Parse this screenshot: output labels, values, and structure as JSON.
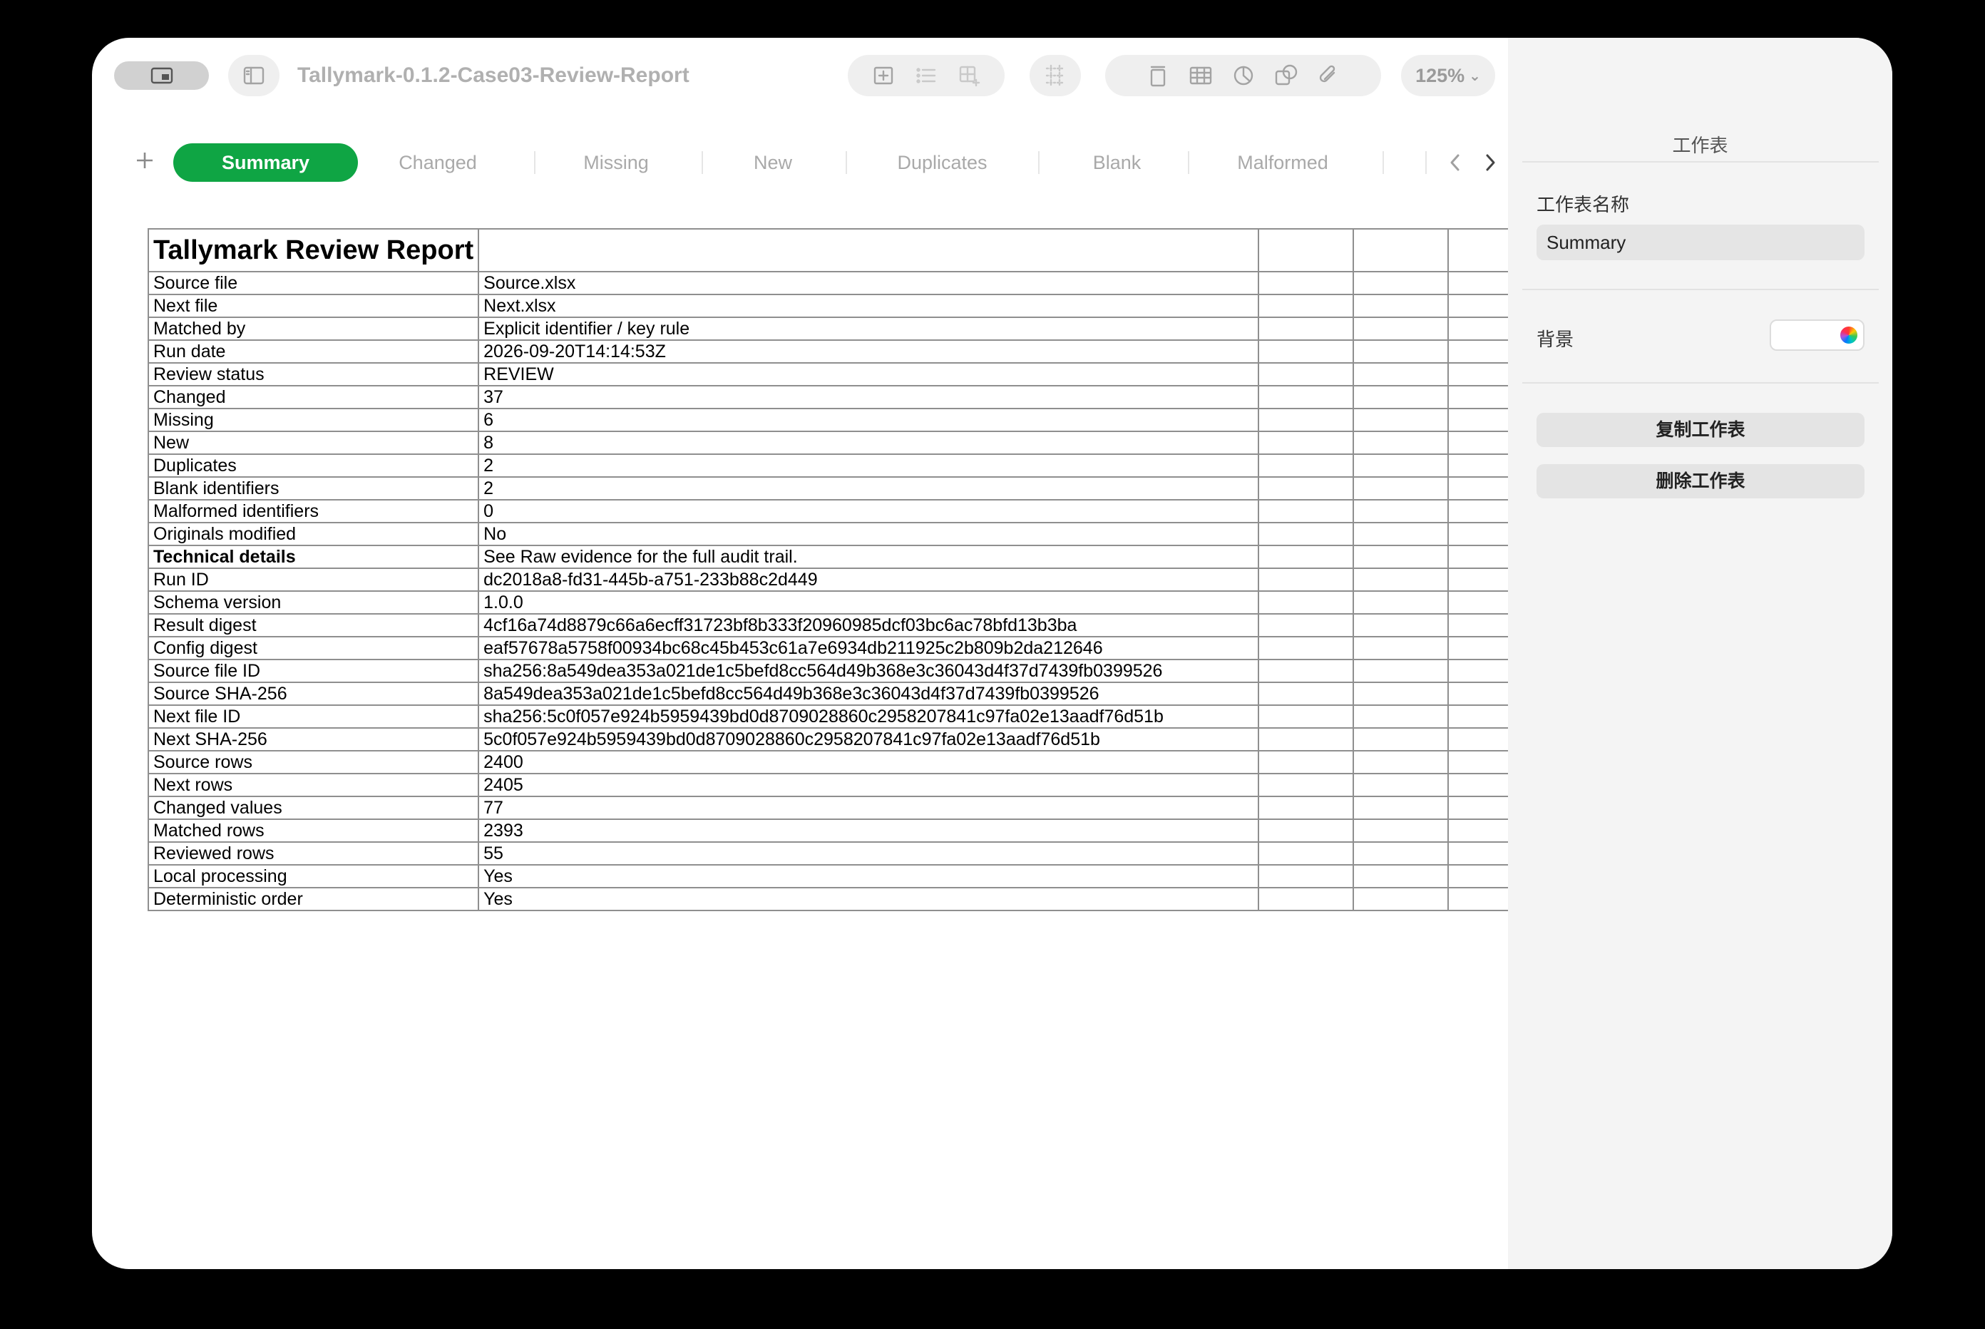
{
  "window": {
    "title": "Tallymark-0.1.2-Case03-Review-Report",
    "zoom": "125%"
  },
  "toolbar": {
    "icons": [
      "sidebar-toggle-icon",
      "sidebar-icon",
      "insert-icon",
      "list-icon",
      "table-add-icon",
      "grid-icon",
      "text-box-icon",
      "table-icon",
      "chart-icon",
      "shape-icon",
      "attachment-icon",
      "comment-icon",
      "share-icon",
      "format-brush-icon",
      "organize-icon"
    ]
  },
  "tabs": [
    {
      "label": "Summary",
      "active": true
    },
    {
      "label": "Changed",
      "active": false
    },
    {
      "label": "Missing",
      "active": false
    },
    {
      "label": "New",
      "active": false
    },
    {
      "label": "Duplicates",
      "active": false
    },
    {
      "label": "Blank",
      "active": false
    },
    {
      "label": "Malformed",
      "active": false
    }
  ],
  "sheet": {
    "title": "Tallymark Review Report",
    "rows": [
      {
        "label": "Source file",
        "value": "Source.xlsx"
      },
      {
        "label": "Next file",
        "value": "Next.xlsx"
      },
      {
        "label": "Matched by",
        "value": "Explicit identifier / key rule"
      },
      {
        "label": "Run date",
        "value": "2026-09-20T14:14:53Z"
      },
      {
        "label": "Review status",
        "value": "REVIEW"
      },
      {
        "label": "Changed",
        "value": "37"
      },
      {
        "label": "Missing",
        "value": "6"
      },
      {
        "label": "New",
        "value": "8"
      },
      {
        "label": "Duplicates",
        "value": "2"
      },
      {
        "label": "Blank identifiers",
        "value": "2"
      },
      {
        "label": "Malformed identifiers",
        "value": "0"
      },
      {
        "label": "Originals modified",
        "value": "No"
      },
      {
        "label": "Technical details",
        "value": "See Raw evidence for the full audit trail.",
        "bold": true
      },
      {
        "label": "Run ID",
        "value": "dc2018a8-fd31-445b-a751-233b88c2d449"
      },
      {
        "label": "Schema version",
        "value": "1.0.0"
      },
      {
        "label": "Result digest",
        "value": "4cf16a74d8879c66a6ecff31723bf8b333f20960985dcf03bc6ac78bfd13b3ba"
      },
      {
        "label": "Config digest",
        "value": "eaf57678a5758f00934bc68c45b453c61a7e6934db211925c2b809b2da212646"
      },
      {
        "label": "Source file ID",
        "value": "sha256:8a549dea353a021de1c5befd8cc564d49b368e3c36043d4f37d7439fb0399526"
      },
      {
        "label": "Source SHA-256",
        "value": "8a549dea353a021de1c5befd8cc564d49b368e3c36043d4f37d7439fb0399526"
      },
      {
        "label": "Next file ID",
        "value": "sha256:5c0f057e924b5959439bd0d8709028860c2958207841c97fa02e13aadf76d51b"
      },
      {
        "label": "Next SHA-256",
        "value": "5c0f057e924b5959439bd0d8709028860c2958207841c97fa02e13aadf76d51b"
      },
      {
        "label": "Source rows",
        "value": "2400"
      },
      {
        "label": "Next rows",
        "value": "2405"
      },
      {
        "label": "Changed values",
        "value": "77"
      },
      {
        "label": "Matched rows",
        "value": "2393"
      },
      {
        "label": "Reviewed rows",
        "value": "55"
      },
      {
        "label": "Local processing",
        "value": "Yes"
      },
      {
        "label": "Deterministic order",
        "value": "Yes"
      }
    ]
  },
  "inspector": {
    "header": "工作表",
    "name_label": "工作表名称",
    "name_value": "Summary",
    "background_label": "背景",
    "background_color": "#ffffff",
    "duplicate_button": "复制工作表",
    "delete_button": "删除工作表"
  },
  "colors": {
    "accent": "#0fa544"
  }
}
